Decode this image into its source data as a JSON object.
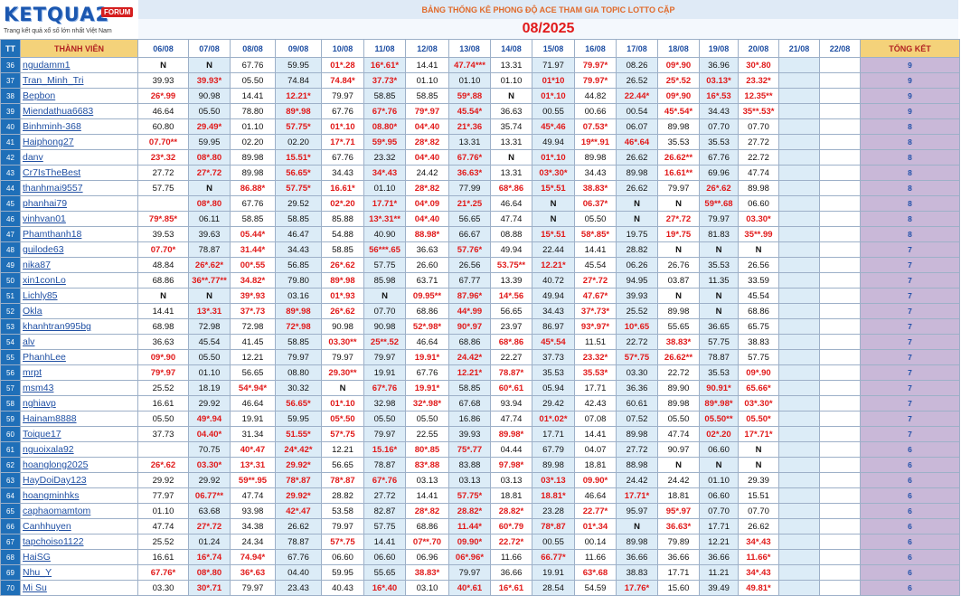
{
  "logo": {
    "brand": "KETQUA2",
    "badge": "FORUM",
    "tagline": "Trang kết quả xổ số lớn nhất Việt Nam"
  },
  "banner": "BẢNG THỐNG KÊ PHONG ĐỘ ACE THAM GIA TOPIC  LOTTO CẶP",
  "month": "08/2025",
  "headers": {
    "tt": "TT",
    "name": "THÀNH VIÊN",
    "days": [
      "06/08",
      "07/08",
      "08/08",
      "09/08",
      "10/08",
      "11/08",
      "12/08",
      "13/08",
      "14/08",
      "15/08",
      "16/08",
      "17/08",
      "18/08",
      "19/08",
      "20/08",
      "21/08",
      "22/08"
    ],
    "total": "TỔNG KẾT"
  },
  "rows": [
    {
      "tt": "36",
      "name": "ngudamm1",
      "cells": [
        "N",
        "N",
        "67.76",
        "59.95",
        "01*.28",
        "16*.61*",
        "14.41",
        "47.74***",
        "13.31",
        "71.97",
        "79.97*",
        "08.26",
        "09*.90",
        "36.96",
        "30*.80"
      ],
      "total": "9"
    },
    {
      "tt": "37",
      "name": "Tran_Minh_Tri",
      "cells": [
        "39.93",
        "39.93*",
        "05.50",
        "74.84",
        "74.84*",
        "37.73*",
        "01.10",
        "01.10",
        "01.10",
        "01*10",
        "79.97*",
        "26.52",
        "25*.52",
        "03.13*",
        "23.32*"
      ],
      "total": "9"
    },
    {
      "tt": "38",
      "name": "Bepbon",
      "cells": [
        "26*.99",
        "90.98",
        "14.41",
        "12.21*",
        "79.97",
        "58.85",
        "58.85",
        "59*.88",
        "N",
        "01*.10",
        "44.82",
        "22.44*",
        "09*.90",
        "16*.53",
        "12.35**"
      ],
      "total": "9"
    },
    {
      "tt": "39",
      "name": "Miendathua6683",
      "cells": [
        "46.64",
        "05.50",
        "78.80",
        "89*.98",
        "67.76",
        "67*.76",
        "79*.97",
        "45.54*",
        "36.63",
        "00.55",
        "00.66",
        "00.54",
        "45*.54*",
        "34.43",
        "35**.53*"
      ],
      "total": "9"
    },
    {
      "tt": "40",
      "name": "Binhminh-368",
      "cells": [
        "60.80",
        "29.49*",
        "01.10",
        "57.75*",
        "01*.10",
        "08.80*",
        "04*.40",
        "21*.36",
        "35.74",
        "45*.46",
        "07.53*",
        "06.07",
        "89.98",
        "07.70",
        "07.70"
      ],
      "total": "8"
    },
    {
      "tt": "41",
      "name": "Haiphong27",
      "cells": [
        "07.70**",
        "59.95",
        "02.20",
        "02.20",
        "17*.71",
        "59*.95",
        "28*.82",
        "13.31",
        "13.31",
        "49.94",
        "19**.91",
        "46*.64",
        "35.53",
        "35.53",
        "27.72"
      ],
      "total": "8"
    },
    {
      "tt": "42",
      "name": "danv",
      "cells": [
        "23*.32",
        "08*.80",
        "89.98",
        "15.51*",
        "67.76",
        "23.32",
        "04*.40",
        "67.76*",
        "N",
        "01*.10",
        "89.98",
        "26.62",
        "26.62**",
        "67.76",
        "22.72"
      ],
      "total": "8"
    },
    {
      "tt": "43",
      "name": "Cr7IsTheBest",
      "cells": [
        "27.72",
        "27*.72",
        "89.98",
        "56.65*",
        "34.43",
        "34*.43",
        "24.42",
        "36.63*",
        "13.31",
        "03*.30*",
        "34.43",
        "89.98",
        "16.61**",
        "69.96",
        "47.74"
      ],
      "total": "8"
    },
    {
      "tt": "44",
      "name": "thanhmai9557",
      "cells": [
        "57.75",
        "N",
        "86.88*",
        "57.75*",
        "16.61*",
        "01.10",
        "28*.82",
        "77.99",
        "68*.86",
        "15*.51",
        "38.83*",
        "26.62",
        "79.97",
        "26*.62",
        "89.98"
      ],
      "total": "8"
    },
    {
      "tt": "45",
      "name": "phanhai79",
      "cells": [
        "",
        "08*.80",
        "67.76",
        "29.52",
        "02*.20",
        "17.71*",
        "04*.09",
        "21*.25",
        "46.64",
        "N",
        "06.37*",
        "N",
        "N",
        "59**.68",
        "06.60"
      ],
      "total": "8"
    },
    {
      "tt": "46",
      "name": "vinhvan01",
      "cells": [
        "79*.85*",
        "06.11",
        "58.85",
        "58.85",
        "85.88",
        "13*.31**",
        "04*.40",
        "56.65",
        "47.74",
        "N",
        "05.50",
        "N",
        "27*.72",
        "79.97",
        "03.30*"
      ],
      "total": "8"
    },
    {
      "tt": "47",
      "name": "Phamthanh18",
      "cells": [
        "39.53",
        "39.63",
        "05.44*",
        "46.47",
        "54.88",
        "40.90",
        "88.98*",
        "66.67",
        "08.88",
        "15*.51",
        "58*.85*",
        "19.75",
        "19*.75",
        "81.83",
        "35**.99"
      ],
      "total": "8"
    },
    {
      "tt": "48",
      "name": "guilode63",
      "cells": [
        "07.70*",
        "78.87",
        "31.44*",
        "34.43",
        "58.85",
        "56***.65",
        "36.63",
        "57.76*",
        "49.94",
        "22.44",
        "14.41",
        "28.82",
        "N",
        "N",
        "N"
      ],
      "total": "7"
    },
    {
      "tt": "49",
      "name": "nika87",
      "cells": [
        "48.84",
        "26*.62*",
        "00*.55",
        "56.85",
        "26*.62",
        "57.75",
        "26.60",
        "26.56",
        "53.75**",
        "12.21*",
        "45.54",
        "06.26",
        "26.76",
        "35.53",
        "26.56"
      ],
      "total": "7"
    },
    {
      "tt": "50",
      "name": "xin1conLo",
      "cells": [
        "68.86",
        "36**.77**",
        "34.82*",
        "79.80",
        "89*.98",
        "85.98",
        "63.71",
        "67.77",
        "13.39",
        "40.72",
        "27*.72",
        "94.95",
        "03.87",
        "11.35",
        "33.59"
      ],
      "total": "7"
    },
    {
      "tt": "51",
      "name": "Lichly85",
      "cells": [
        "N",
        "N",
        "39*.93",
        "03.16",
        "01*.93",
        "N",
        "09.95**",
        "87.96*",
        "14*.56",
        "49.94",
        "47.67*",
        "39.93",
        "N",
        "N",
        "45.54"
      ],
      "total": "7"
    },
    {
      "tt": "52",
      "name": "Okla",
      "cells": [
        "14.41",
        "13*.31",
        "37*.73",
        "89*.98",
        "26*.62",
        "07.70",
        "68.86",
        "44*.99",
        "56.65",
        "34.43",
        "37*.73*",
        "25.52",
        "89.98",
        "N",
        "68.86"
      ],
      "total": "7"
    },
    {
      "tt": "53",
      "name": "khanhtran995bg",
      "cells": [
        "68.98",
        "72.98",
        "72.98",
        "72*.98",
        "90.98",
        "90.98",
        "52*.98*",
        "90*.97",
        "23.97",
        "86.97",
        "93*.97*",
        "10*.65",
        "55.65",
        "36.65",
        "65.75"
      ],
      "total": "7"
    },
    {
      "tt": "54",
      "name": "alv",
      "cells": [
        "36.63",
        "45.54",
        "41.45",
        "58.85",
        "03.30**",
        "25**.52",
        "46.64",
        "68.86",
        "68*.86",
        "45*.54",
        "11.51",
        "22.72",
        "38.83*",
        "57.75",
        "38.83"
      ],
      "total": "7"
    },
    {
      "tt": "55",
      "name": "PhanhLee",
      "cells": [
        "09*.90",
        "05.50",
        "12.21",
        "79.97",
        "79.97",
        "79.97",
        "19.91*",
        "24.42*",
        "22.27",
        "37.73",
        "23.32*",
        "57*.75",
        "26.62**",
        "78.87",
        "57.75"
      ],
      "total": "7"
    },
    {
      "tt": "56",
      "name": "mrpt",
      "cells": [
        "79*.97",
        "01.10",
        "56.65",
        "08.80",
        "29.30**",
        "19.91",
        "67.76",
        "12.21*",
        "78.87*",
        "35.53",
        "35.53*",
        "03.30",
        "22.72",
        "35.53",
        "09*.90"
      ],
      "total": "7"
    },
    {
      "tt": "57",
      "name": "msm43",
      "cells": [
        "25.52",
        "18.19",
        "54*.94*",
        "30.32",
        "N",
        "67*.76",
        "19.91*",
        "58.85",
        "60*.61",
        "05.94",
        "17.71",
        "36.36",
        "89.90",
        "90.91*",
        "65.66*"
      ],
      "total": "7"
    },
    {
      "tt": "58",
      "name": "nghiavp",
      "cells": [
        "16.61",
        "29.92",
        "46.64",
        "56.65*",
        "01*.10",
        "32.98",
        "32*.98*",
        "67.68",
        "93.94",
        "29.42",
        "42.43",
        "60.61",
        "89.98",
        "89*.98*",
        "03*.30*"
      ],
      "total": "7"
    },
    {
      "tt": "59",
      "name": "Hainam8888",
      "cells": [
        "05.50",
        "49*.94",
        "19.91",
        "59.95",
        "05*.50",
        "05.50",
        "05.50",
        "16.86",
        "47.74",
        "01*.02*",
        "07.08",
        "07.52",
        "05.50",
        "05.50**",
        "05.50*"
      ],
      "total": "7"
    },
    {
      "tt": "60",
      "name": "Toique17",
      "cells": [
        "37.73",
        "04.40*",
        "31.34",
        "51.55*",
        "57*.75",
        "79.97",
        "22.55",
        "39.93",
        "89.98*",
        "17.71",
        "14.41",
        "89.98",
        "47.74",
        "02*.20",
        "17*.71*"
      ],
      "total": "7"
    },
    {
      "tt": "61",
      "name": "nguoixala92",
      "cells": [
        "",
        "70.75",
        "40*.47",
        "24*.42*",
        "12.21",
        "15.16*",
        "80*.85",
        "75*.77",
        "04.44",
        "67.79",
        "04.07",
        "27.72",
        "90.97",
        "06.60",
        "N"
      ],
      "total": "6"
    },
    {
      "tt": "62",
      "name": "hoanglong2025",
      "cells": [
        "26*.62",
        "03.30*",
        "13*.31",
        "29.92*",
        "56.65",
        "78.87",
        "83*.88",
        "83.88",
        "97.98*",
        "89.98",
        "18.81",
        "88.98",
        "N",
        "N",
        "N"
      ],
      "total": "6"
    },
    {
      "tt": "63",
      "name": "HayDoiDay123",
      "cells": [
        "29.92",
        "29.92",
        "59**.95",
        "78*.87",
        "78*.87",
        "67*.76",
        "03.13",
        "03.13",
        "03.13",
        "03*.13",
        "09.90*",
        "24.42",
        "24.42",
        "01.10",
        "29.39"
      ],
      "total": "6"
    },
    {
      "tt": "64",
      "name": "hoangminhks",
      "cells": [
        "77.97",
        "06.77**",
        "47.74",
        "29.92*",
        "28.82",
        "27.72",
        "14.41",
        "57.75*",
        "18.81",
        "18.81*",
        "46.64",
        "17.71*",
        "18.81",
        "06.60",
        "15.51"
      ],
      "total": "6"
    },
    {
      "tt": "65",
      "name": "caphaomamtom",
      "cells": [
        "01.10",
        "63.68",
        "93.98",
        "42*.47",
        "53.58",
        "82.87",
        "28*.82",
        "28.82*",
        "28.82*",
        "23.28",
        "22.77*",
        "95.97",
        "95*.97",
        "07.70",
        "07.70"
      ],
      "total": "6"
    },
    {
      "tt": "66",
      "name": "Canhhuyen",
      "cells": [
        "47.74",
        "27*.72",
        "34.38",
        "26.62",
        "79.97",
        "57.75",
        "68.86",
        "11.44*",
        "60*.79",
        "78*.87",
        "01*.34",
        "N",
        "36.63*",
        "17.71",
        "26.62"
      ],
      "total": "6"
    },
    {
      "tt": "67",
      "name": "tapchoiso1122",
      "cells": [
        "25.52",
        "01.24",
        "24.34",
        "78.87",
        "57*.75",
        "14.41",
        "07**.70",
        "09.90*",
        "22.72*",
        "00.55",
        "00.14",
        "89.98",
        "79.89",
        "12.21",
        "34*.43"
      ],
      "total": "6"
    },
    {
      "tt": "68",
      "name": "HaiSG",
      "cells": [
        "16.61",
        "16*.74",
        "74.94*",
        "67.76",
        "06.60",
        "06.60",
        "06.96",
        "06*.96*",
        "11.66",
        "66.77*",
        "11.66",
        "36.66",
        "36.66",
        "36.66",
        "11.66*"
      ],
      "total": "6"
    },
    {
      "tt": "69",
      "name": "Nhu_Y",
      "cells": [
        "67.76*",
        "08*.80",
        "36*.63",
        "04.40",
        "59.95",
        "55.65",
        "38.83*",
        "79.97",
        "36.66",
        "19.91",
        "63*.68",
        "38.83",
        "17.71",
        "11.21",
        "34*.43"
      ],
      "total": "6"
    },
    {
      "tt": "70",
      "name": "Mi Su",
      "cells": [
        "03.30",
        "30*.71",
        "79.97",
        "23.43",
        "40.43",
        "16*.40",
        "03.10",
        "40*.61",
        "16*.61",
        "28.54",
        "54.59",
        "17.76*",
        "15.60",
        "39.49",
        "49.81*"
      ],
      "total": "6"
    }
  ]
}
